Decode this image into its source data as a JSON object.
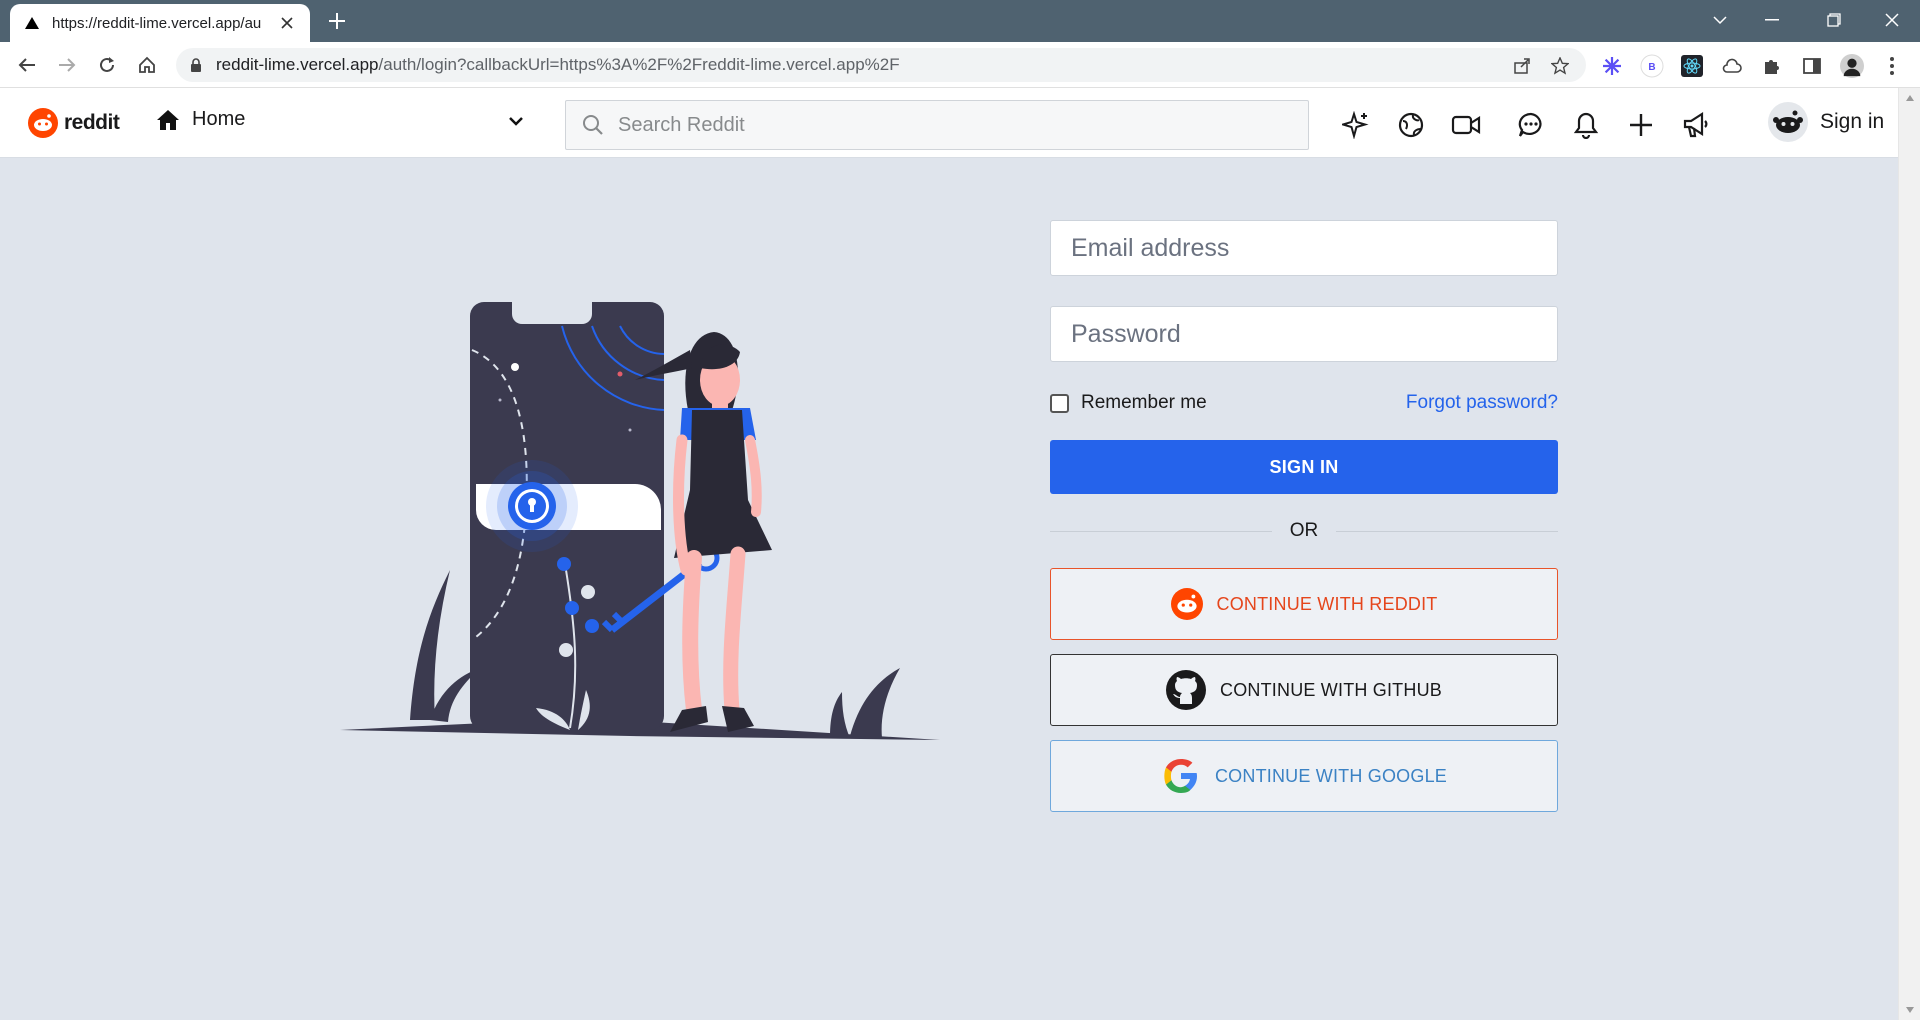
{
  "browser": {
    "tab_title": "https://reddit-lime.vercel.app/au",
    "url_host": "reddit-lime.vercel.app",
    "url_path": "/auth/login?callbackUrl=https%3A%2F%2Freddit-lime.vercel.app%2F"
  },
  "header": {
    "logo_text": "reddit",
    "home_label": "Home",
    "search_placeholder": "Search Reddit",
    "signin_label": "Sign in"
  },
  "form": {
    "email_placeholder": "Email address",
    "password_placeholder": "Password",
    "remember_label": "Remember me",
    "forgot_label": "Forgot password?",
    "signin_button": "SIGN IN",
    "or_label": "OR",
    "reddit_button": "CONTINUE WITH REDDIT",
    "github_button": "CONTINUE WITH GITHUB",
    "google_button": "CONTINUE WITH GOOGLE"
  },
  "colors": {
    "primary": "#2563eb",
    "reddit": "#ff4500",
    "background": "#dfe4ec"
  }
}
